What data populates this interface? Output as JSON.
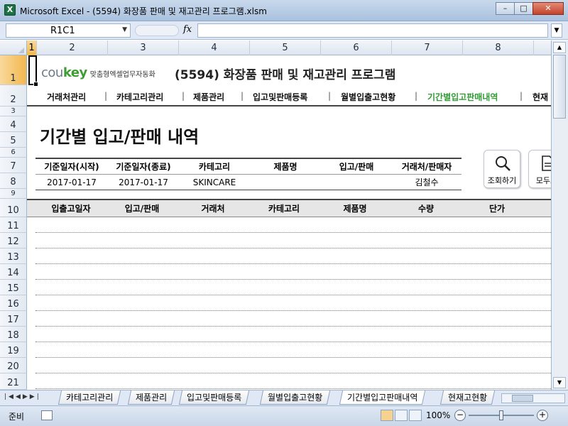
{
  "window": {
    "title": "Microsoft Excel - (5594) 화장품 판매 및 재고관리 프로그램.xlsm",
    "app_icon": "X",
    "controls": [
      "–",
      "□",
      "✕"
    ]
  },
  "formula_bar": {
    "name_box": "R1C1",
    "fx": "fx",
    "value": ""
  },
  "columns": [
    "1",
    "2",
    "3",
    "4",
    "5",
    "6",
    "7",
    "8"
  ],
  "rows": [
    "1",
    "2",
    "3",
    "4",
    "5",
    "6",
    "7",
    "8",
    "9",
    "10",
    "11",
    "12",
    "13",
    "14",
    "15",
    "16",
    "17",
    "18",
    "19",
    "20",
    "21"
  ],
  "logo": {
    "brand_prefix": "cou",
    "brand_suffix": "key",
    "tagline": "맞춤형엑셀업무자동화"
  },
  "app_title": "(5594) 화장품 판매 및 재고관리 프로그램",
  "nav": {
    "items": [
      "거래처관리",
      "카테고리관리",
      "제품관리",
      "입고및판매등록",
      "월별입출고현황",
      "기간별입고판매내역",
      "현재"
    ],
    "separator": "|"
  },
  "page_title": "기간별 입고/판매 내역",
  "filter": {
    "headers": [
      "기준일자(시작)",
      "기준일자(종료)",
      "카테고리",
      "제품명",
      "입고/판매",
      "거래처/판매자"
    ],
    "values": [
      "2017-01-17",
      "2017-01-17",
      "SKINCARE",
      "",
      "",
      "김철수"
    ]
  },
  "buttons": {
    "search": "조회하기",
    "all": "모두표"
  },
  "table": {
    "headers": [
      "입출고일자",
      "입고/판매",
      "거래처",
      "카테고리",
      "제품명",
      "수량",
      "단가"
    ]
  },
  "sheet_tabs": [
    "카테고리관리",
    "제품관리",
    "입고및판매등록",
    "월별입출고현황",
    "기간별입고판매내역",
    "현재고현황"
  ],
  "active_tab": "기간별입고판매내역",
  "status": {
    "ready": "준비",
    "zoom": "100%",
    "minus": "−",
    "plus": "+"
  },
  "accent_color": "#2e9c33"
}
